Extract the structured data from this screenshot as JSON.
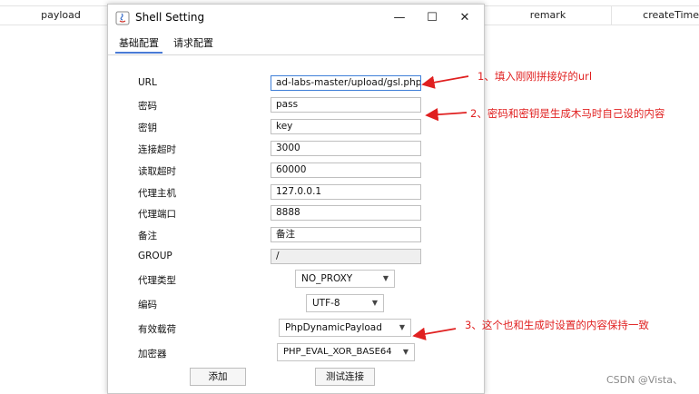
{
  "background_table": {
    "columns": [
      "payload",
      "remark",
      "createTime"
    ]
  },
  "dialog": {
    "title": "Shell Setting",
    "window_controls": {
      "minimize": "—",
      "maximize": "☐",
      "close": "✕"
    },
    "tabs": [
      {
        "label": "基础配置",
        "active": true
      },
      {
        "label": "请求配置",
        "active": false
      }
    ],
    "fields": [
      {
        "label": "URL",
        "value": "ad-labs-master/upload/gsl.php"
      },
      {
        "label": "密码",
        "value": "pass"
      },
      {
        "label": "密钥",
        "value": "key"
      },
      {
        "label": "连接超时",
        "value": "3000"
      },
      {
        "label": "读取超时",
        "value": "60000"
      },
      {
        "label": "代理主机",
        "value": "127.0.0.1"
      },
      {
        "label": "代理端口",
        "value": "8888"
      },
      {
        "label": "备注",
        "value": "备注"
      },
      {
        "label": "GROUP",
        "value": "/"
      }
    ],
    "selects": [
      {
        "label": "代理类型",
        "value": "NO_PROXY"
      },
      {
        "label": "编码",
        "value": "UTF-8"
      },
      {
        "label": "有效载荷",
        "value": "PhpDynamicPayload"
      },
      {
        "label": "加密器",
        "value": "PHP_EVAL_XOR_BASE64"
      }
    ],
    "buttons": {
      "add": "添加",
      "test": "测试连接"
    }
  },
  "annotations": [
    "1、填入刚刚拼接好的url",
    "2、密码和密钥是生成木马时自己设的内容",
    "3、这个也和生成时设置的内容保持一致"
  ],
  "watermark": "CSDN @Vista、",
  "colors": {
    "annotation": "#e02020",
    "tab_active": "#4a7bd6",
    "focus_border": "#3f7fd8"
  }
}
